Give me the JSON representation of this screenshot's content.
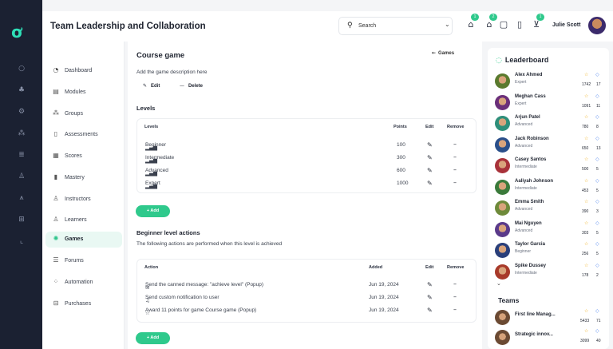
{
  "header": {
    "title": "Team Leadership and Collaboration",
    "search_value": "Search",
    "user_name": "Julie Scott",
    "badges": [
      "1",
      "2",
      "1"
    ]
  },
  "sidebar": {
    "items": [
      {
        "label": "Dashboard",
        "icon": "dashboard-icon"
      },
      {
        "label": "Modules",
        "icon": "modules-icon"
      },
      {
        "label": "Groups",
        "icon": "groups-icon"
      },
      {
        "label": "Assessments",
        "icon": "assessments-icon"
      },
      {
        "label": "Scores",
        "icon": "scores-icon"
      },
      {
        "label": "Mastery",
        "icon": "mastery-icon"
      },
      {
        "label": "Instructors",
        "icon": "instructors-icon"
      },
      {
        "label": "Learners",
        "icon": "learners-icon"
      },
      {
        "label": "Games",
        "icon": "games-icon",
        "active": true
      },
      {
        "label": "Forums",
        "icon": "forums-icon"
      },
      {
        "label": "Automation",
        "icon": "automation-icon"
      },
      {
        "label": "Purchases",
        "icon": "purchases-icon"
      }
    ]
  },
  "main": {
    "title": "Course game",
    "games_link": "Games",
    "description": "Add the game description here",
    "edit_label": "Edit",
    "delete_label": "Delete",
    "levels_title": "Levels",
    "levels_columns": [
      "Levels",
      "Points",
      "Edit",
      "Remove"
    ],
    "levels": [
      {
        "name": "Beginner",
        "points": "100"
      },
      {
        "name": "Intermediate",
        "points": "300"
      },
      {
        "name": "Advanced",
        "points": "600"
      },
      {
        "name": "Expert",
        "points": "1000"
      }
    ],
    "add_label": "+ Add",
    "actions_title": "Beginner level actions",
    "actions_desc": "The following actions are performed when this level is achieved",
    "actions_columns": [
      "Action",
      "Added",
      "Edit",
      "Remove"
    ],
    "actions": [
      {
        "icon": "message-icon",
        "text": "Send the canned message: \"achieve level\" (Popup)",
        "added": "Jun 19, 2024"
      },
      {
        "icon": "bell-icon",
        "text": "Send custom notification to user",
        "added": "Jun 19, 2024"
      },
      {
        "icon": "star-icon",
        "text": "Award 11 points for game Course game (Popup)",
        "added": "Jun 19, 2024"
      }
    ]
  },
  "leaderboard": {
    "title": "Leaderboard",
    "entries": [
      {
        "name": "Alex Ahmed",
        "level": "Expert",
        "points": "1742",
        "badges": "17",
        "color": "#5a7a2e"
      },
      {
        "name": "Meghan Cass",
        "level": "Expert",
        "points": "1091",
        "badges": "11",
        "color": "#6b2f7a"
      },
      {
        "name": "Arjun Patel",
        "level": "Advanced",
        "points": "780",
        "badges": "8",
        "color": "#2e8f7a"
      },
      {
        "name": "Jack Robinson",
        "level": "Advanced",
        "points": "650",
        "badges": "13",
        "color": "#2a4f8a"
      },
      {
        "name": "Casey Santos",
        "level": "Intermediate",
        "points": "500",
        "badges": "5",
        "color": "#a8323a"
      },
      {
        "name": "Aaliyah Johnson",
        "level": "Intermediate",
        "points": "453",
        "badges": "5",
        "color": "#3a7a3a"
      },
      {
        "name": "Emma Smith",
        "level": "Advanced",
        "points": "390",
        "badges": "3",
        "color": "#6e8a3a"
      },
      {
        "name": "Mai Nguyen",
        "level": "Advanced",
        "points": "303",
        "badges": "5",
        "color": "#5a3a8a"
      },
      {
        "name": "Taylor Garcia",
        "level": "Beginner",
        "points": "256",
        "badges": "5",
        "color": "#2a3f7a"
      },
      {
        "name": "Spike Dussey",
        "level": "Intermediate",
        "points": "178",
        "badges": "2",
        "color": "#a83a2a"
      }
    ],
    "teams_title": "Teams",
    "teams": [
      {
        "name": "First line Manag...",
        "points": "5433",
        "badges": "71"
      },
      {
        "name": "Strategic innov...",
        "points": "3099",
        "badges": "40"
      }
    ]
  },
  "colors": {
    "accent": "#2fc98c",
    "rail": "#1b2132",
    "logo": "#2ee0b8"
  }
}
